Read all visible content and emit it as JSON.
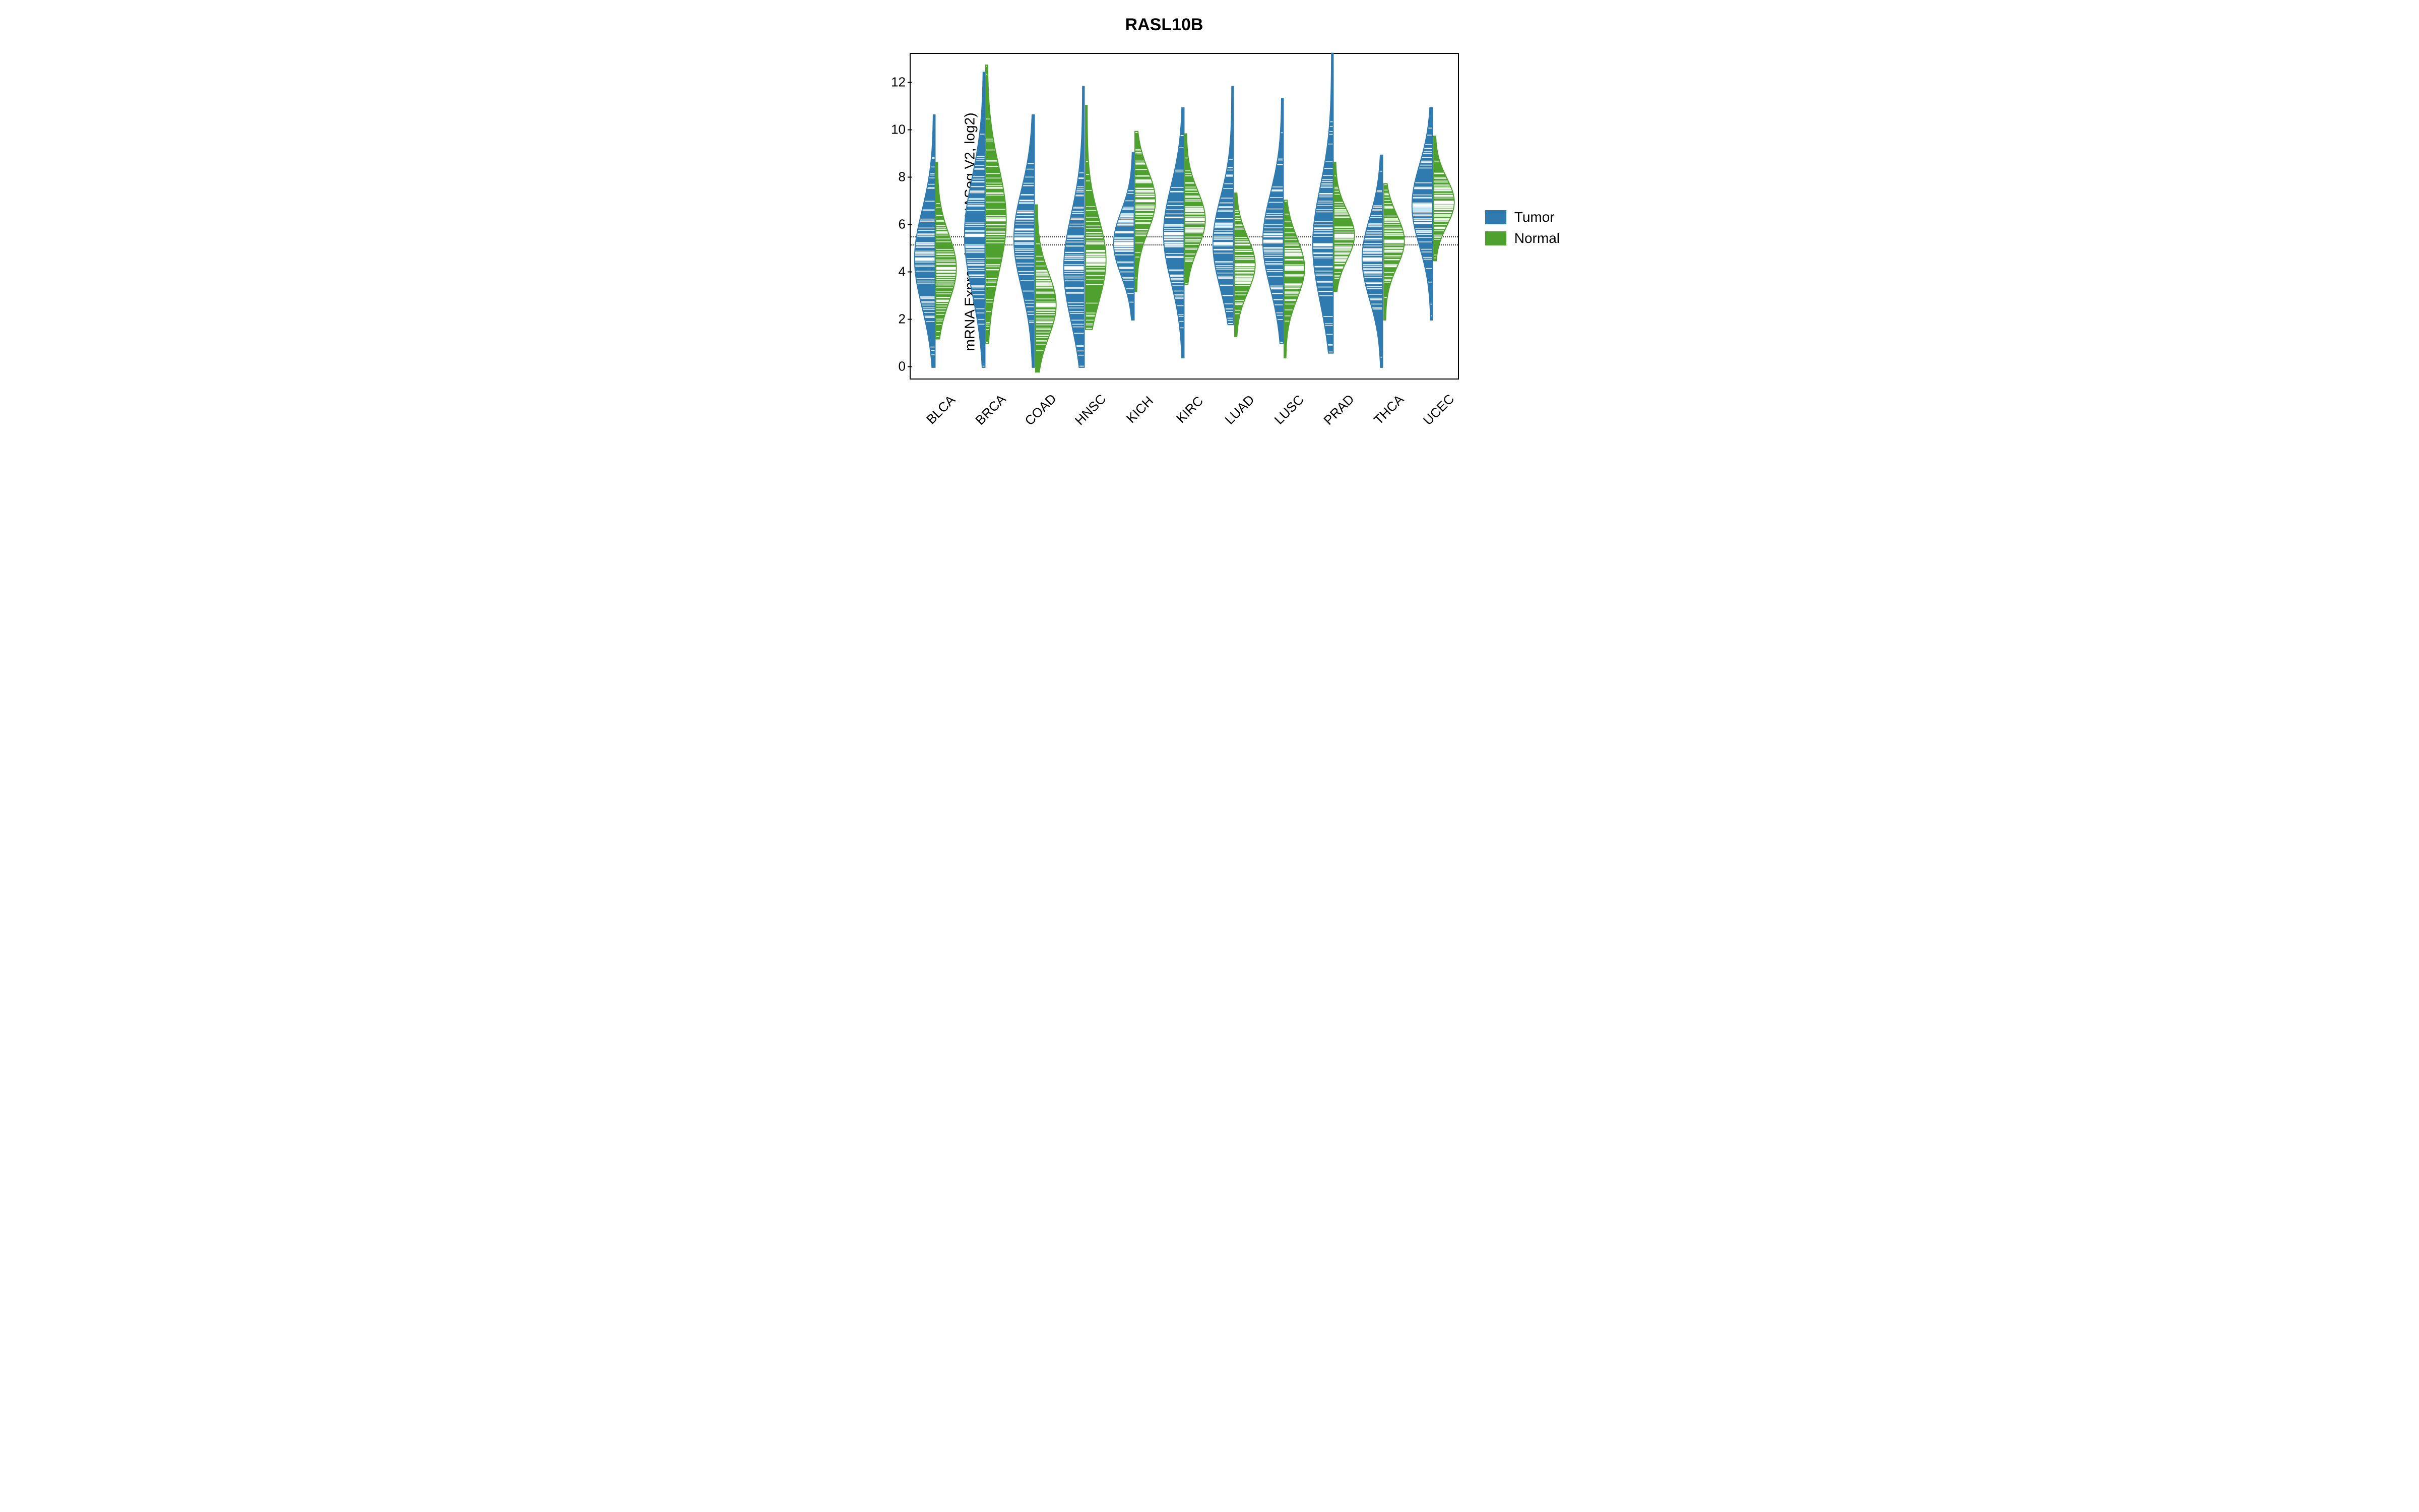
{
  "chart_data": {
    "type": "violin-bean",
    "title": "RASL10B",
    "ylabel": "mRNA Expression (RNASeq V2, log2)",
    "xlabel": "",
    "ylim": [
      -0.5,
      13.2
    ],
    "yticks": [
      0,
      2,
      4,
      6,
      8,
      10,
      12
    ],
    "reference_lines": [
      5.5,
      5.15
    ],
    "categories": [
      "BLCA",
      "BRCA",
      "COAD",
      "HNSC",
      "KICH",
      "KIRC",
      "LUAD",
      "LUSC",
      "PRAD",
      "THCA",
      "UCEC"
    ],
    "series": [
      {
        "name": "Tumor",
        "color": "#2f7bb0",
        "medians": [
          4.55,
          5.55,
          5.4,
          4.15,
          5.2,
          5.6,
          5.2,
          5.3,
          5.15,
          4.55,
          6.8
        ],
        "range": [
          [
            0.0,
            10.6
          ],
          [
            0.0,
            12.4
          ],
          [
            0.0,
            10.6
          ],
          [
            0.0,
            11.8
          ],
          [
            2.0,
            9.0
          ],
          [
            0.4,
            10.9
          ],
          [
            1.8,
            11.8
          ],
          [
            1.0,
            11.3
          ],
          [
            0.6,
            13.2
          ],
          [
            0.0,
            8.9
          ],
          [
            2.0,
            10.9
          ]
        ]
      },
      {
        "name": "Normal",
        "color": "#4ea02f",
        "medians": [
          4.15,
          6.2,
          2.6,
          4.5,
          7.0,
          6.2,
          4.3,
          4.15,
          5.55,
          5.3,
          6.95
        ],
        "range": [
          [
            1.2,
            8.6
          ],
          [
            1.0,
            12.7
          ],
          [
            -0.2,
            6.8
          ],
          [
            1.6,
            11.0
          ],
          [
            3.2,
            9.9
          ],
          [
            3.5,
            9.8
          ],
          [
            1.3,
            7.3
          ],
          [
            0.4,
            7.0
          ],
          [
            3.2,
            8.6
          ],
          [
            2.0,
            7.7
          ],
          [
            4.5,
            9.7
          ]
        ]
      }
    ],
    "legend": {
      "position": "right",
      "entries": [
        {
          "label": "Tumor",
          "color": "#2f7bb0"
        },
        {
          "label": "Normal",
          "color": "#4ea02f"
        }
      ]
    }
  }
}
